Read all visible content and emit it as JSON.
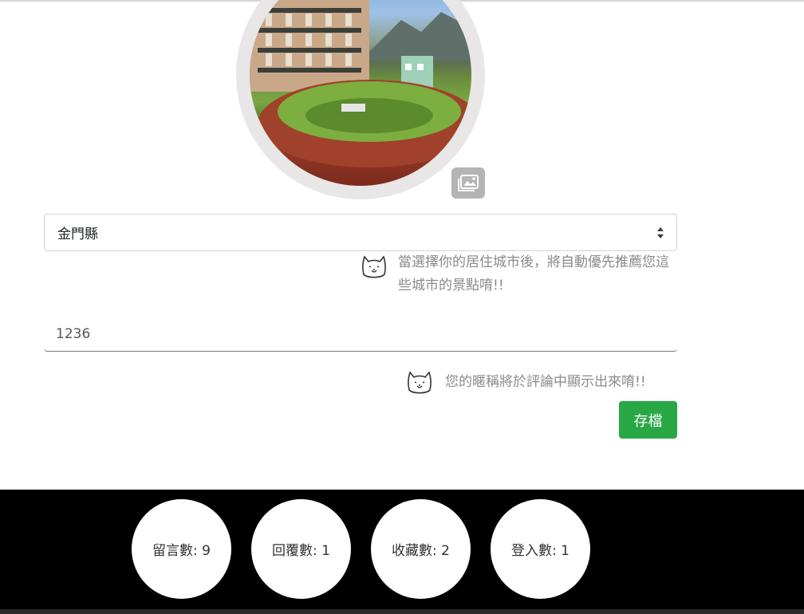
{
  "profile": {
    "city_selected": "金門縣",
    "city_hint": "當選擇你的居住城市後，將自動優先推薦您這些城市的景點唷!!",
    "nickname_value": "1236",
    "nickname_hint": "您的暱稱將於評論中顯示出來唷!!",
    "save_label": "存檔"
  },
  "icons": {
    "photo_upload": "image-icon",
    "hint_icon": "cat-icon",
    "select_arrows": "sort-arrows-icon"
  },
  "stats": [
    {
      "label": "留言數: 9"
    },
    {
      "label": "回覆數: 1"
    },
    {
      "label": "收藏數: 2"
    },
    {
      "label": "登入數: 1"
    }
  ],
  "colors": {
    "save_button": "#28a745",
    "footer_bg": "#000000"
  }
}
